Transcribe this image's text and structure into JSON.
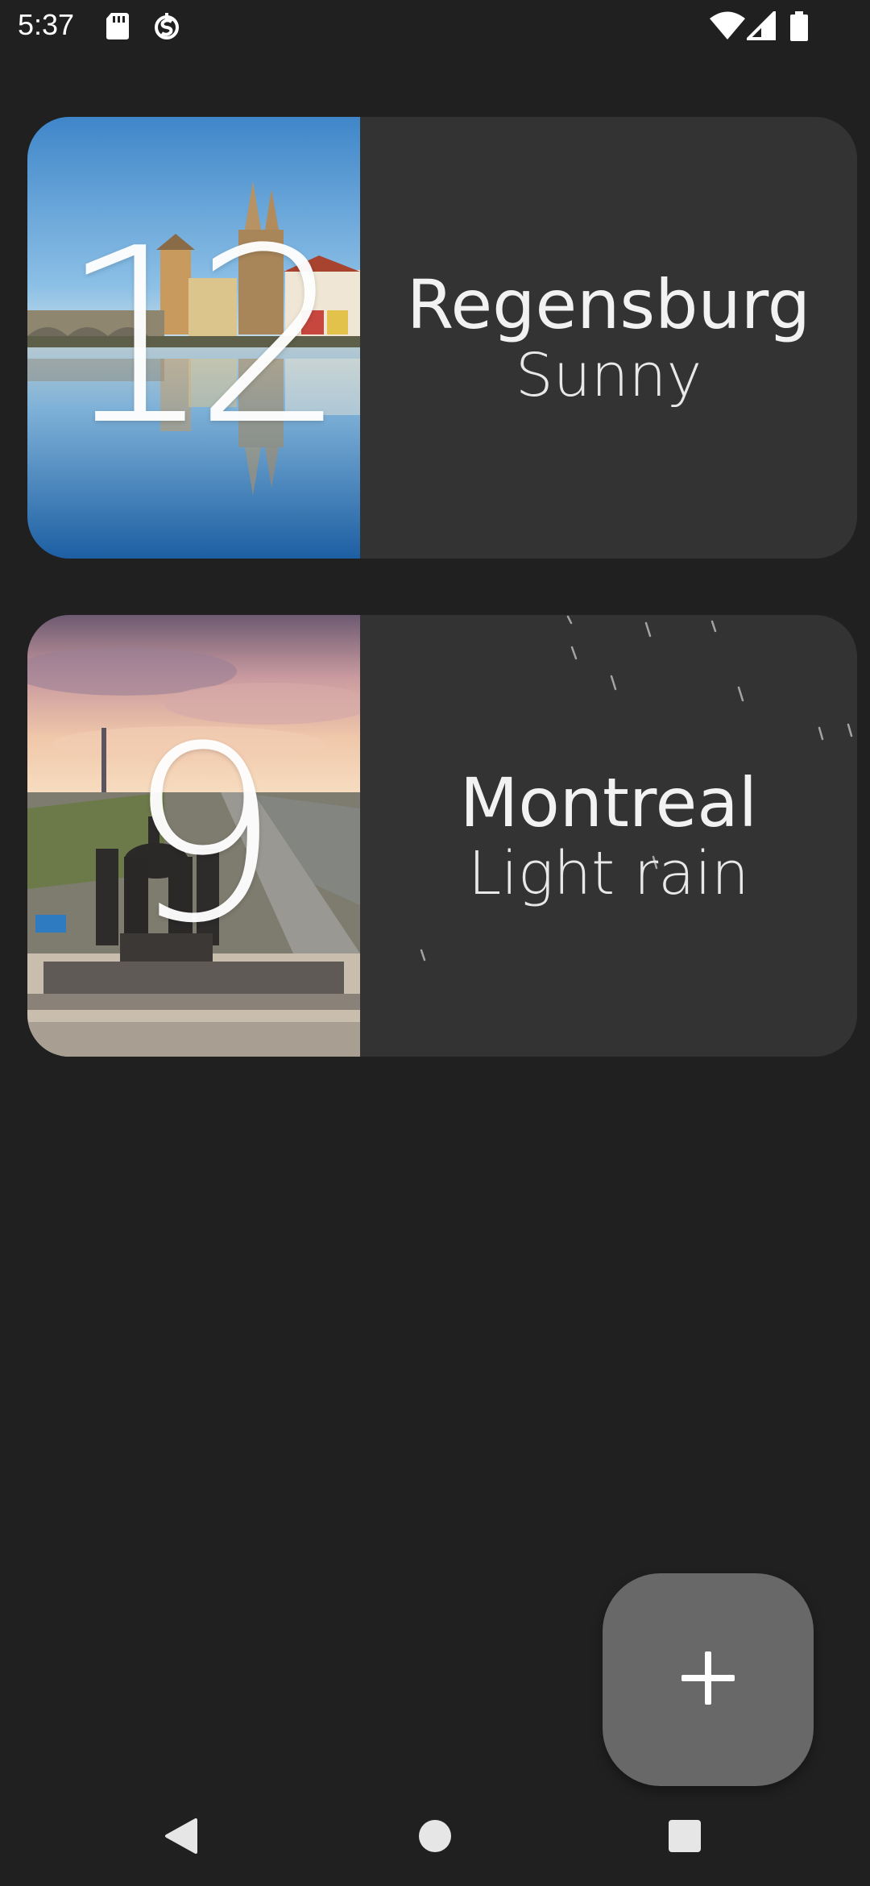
{
  "status_bar": {
    "time": "5:37",
    "icons": [
      "sd-card-icon",
      "vpn-icon",
      "wifi-icon",
      "signal-icon",
      "battery-icon"
    ]
  },
  "cards": [
    {
      "temperature": "12",
      "city": "Regensburg",
      "condition": "Sunny",
      "photo": "regensburg-cathedral-river-photo"
    },
    {
      "temperature": "9",
      "city": "Montreal",
      "condition": "Light rain",
      "photo": "quadriga-monument-avenue-photo"
    }
  ],
  "fab": {
    "icon": "plus-icon"
  },
  "nav": {
    "icons": [
      "back-icon",
      "home-icon",
      "recents-icon"
    ]
  },
  "colors": {
    "background": "#202020",
    "card": "#333333",
    "fab": "#686868"
  }
}
